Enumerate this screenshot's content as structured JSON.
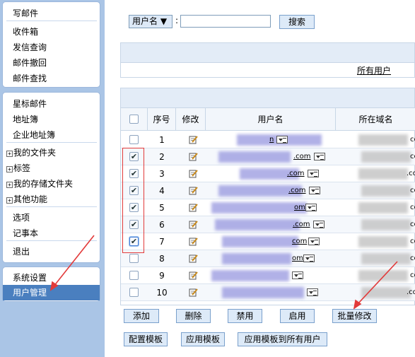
{
  "sidebar": {
    "group1": [
      "写邮件",
      "收件箱",
      "发信查询",
      "邮件撤回",
      "邮件查找"
    ],
    "group2": [
      "星标邮件",
      "地址簿",
      "企业地址簿",
      "我的文件夹",
      "标签",
      "我的存储文件夹",
      "其他功能",
      "选项",
      "记事本",
      "退出"
    ],
    "group3": [
      "系统设置",
      "用户管理"
    ],
    "active": "用户管理"
  },
  "search": {
    "field_label": "用户名 ▼",
    "colon": ":",
    "input_value": "",
    "button": "搜索"
  },
  "info": {
    "all_users_link": "所有用户"
  },
  "table": {
    "headers": [
      "序号",
      "修改",
      "用户名",
      "所在域名"
    ],
    "rows": [
      {
        "n": "1",
        "checked": false,
        "suffix": "n",
        "dom": "com"
      },
      {
        "n": "2",
        "checked": true,
        "suffix": ".com",
        "dom": "com"
      },
      {
        "n": "3",
        "checked": true,
        "suffix": ".com",
        "dom": ".com"
      },
      {
        "n": "4",
        "checked": true,
        "suffix": ".com",
        "dom": "com"
      },
      {
        "n": "5",
        "checked": true,
        "suffix": "om",
        "dom": "com"
      },
      {
        "n": "6",
        "checked": true,
        "suffix": ".com",
        "dom": "com"
      },
      {
        "n": "7",
        "checked": true,
        "suffix": "com",
        "dom": "com"
      },
      {
        "n": "8",
        "checked": false,
        "suffix": "om",
        "dom": "com"
      },
      {
        "n": "9",
        "checked": false,
        "suffix": "",
        "dom": "com"
      },
      {
        "n": "10",
        "checked": false,
        "suffix": "",
        "dom": ".com"
      }
    ]
  },
  "actions": {
    "row1": [
      "添加",
      "删除",
      "禁用",
      "启用",
      "批量修改"
    ],
    "row2": [
      "配置模板",
      "应用模板",
      "应用模板到所有用户"
    ]
  },
  "colors": {
    "sidebar_bg": "#aac5e6",
    "active_bg": "#4a7fbf",
    "annotation": "#e23a3a"
  }
}
